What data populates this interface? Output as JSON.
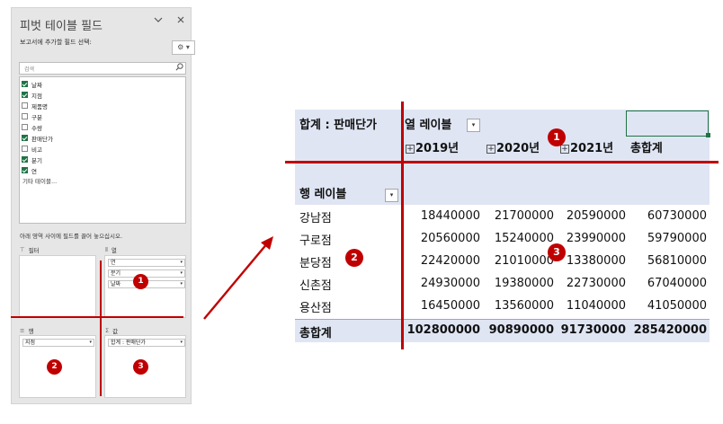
{
  "field_panel": {
    "title": "피벗 테이블 필드",
    "chevron_icon": "chevron-down-icon",
    "close_icon": "close-icon",
    "choose_fields_label": "보고서에 추가할 필드 선택:",
    "gear_icon": "⚙ ▾",
    "search_placeholder": "검색",
    "search_icon": "⚲",
    "fields": [
      {
        "name": "날짜",
        "checked": true
      },
      {
        "name": "지점",
        "checked": true
      },
      {
        "name": "제품명",
        "checked": false
      },
      {
        "name": "구분",
        "checked": false
      },
      {
        "name": "수량",
        "checked": false
      },
      {
        "name": "판매단가",
        "checked": true
      },
      {
        "name": "비고",
        "checked": false
      },
      {
        "name": "분기",
        "checked": true
      },
      {
        "name": "연",
        "checked": true
      }
    ],
    "more_tables": "기타 테이블...",
    "drag_instruction": "아래 영역 사이에 필드를 끌어 놓으십시오.",
    "areas": {
      "filter": {
        "label": "필터",
        "icon": "⊤"
      },
      "columns": {
        "label": "열",
        "icon": "⦀",
        "pills": [
          "연",
          "분기",
          "날짜"
        ]
      },
      "rows": {
        "label": "행",
        "icon": "≡",
        "pills": [
          "지점"
        ]
      },
      "values": {
        "label": "값",
        "icon": "Σ",
        "pills": [
          "합계 : 판매단가"
        ]
      }
    },
    "dropdown_glyph": "▾"
  },
  "markers": {
    "one": "1",
    "two": "2",
    "three": "3"
  },
  "pivot": {
    "value_field_label": "합계 : 판매단가",
    "col_labels_caption": "열 레이블",
    "row_labels_caption": "행 레이블",
    "filter_glyph": "▾",
    "expand_glyph": "+",
    "year_headers": [
      "2019년",
      "2020년",
      "2021년"
    ],
    "grand_total_col": "총합계",
    "rows": [
      {
        "label": "강남점",
        "values": [
          "18440000",
          "21700000",
          "20590000",
          "60730000"
        ]
      },
      {
        "label": "구로점",
        "values": [
          "20560000",
          "15240000",
          "23990000",
          "59790000"
        ]
      },
      {
        "label": "분당점",
        "values": [
          "22420000",
          "21010000",
          "13380000",
          "56810000"
        ]
      },
      {
        "label": "신촌점",
        "values": [
          "24930000",
          "19380000",
          "22730000",
          "67040000"
        ]
      },
      {
        "label": "용산점",
        "values": [
          "16450000",
          "13560000",
          "11040000",
          "41050000"
        ]
      }
    ],
    "grand_total_row": {
      "label": "총합계",
      "values": [
        "102800000",
        "90890000",
        "91730000",
        "285420000"
      ]
    }
  },
  "colors": {
    "accent_red": "#c00000",
    "header_fill": "#dfe5f3",
    "excel_green": "#217346"
  }
}
